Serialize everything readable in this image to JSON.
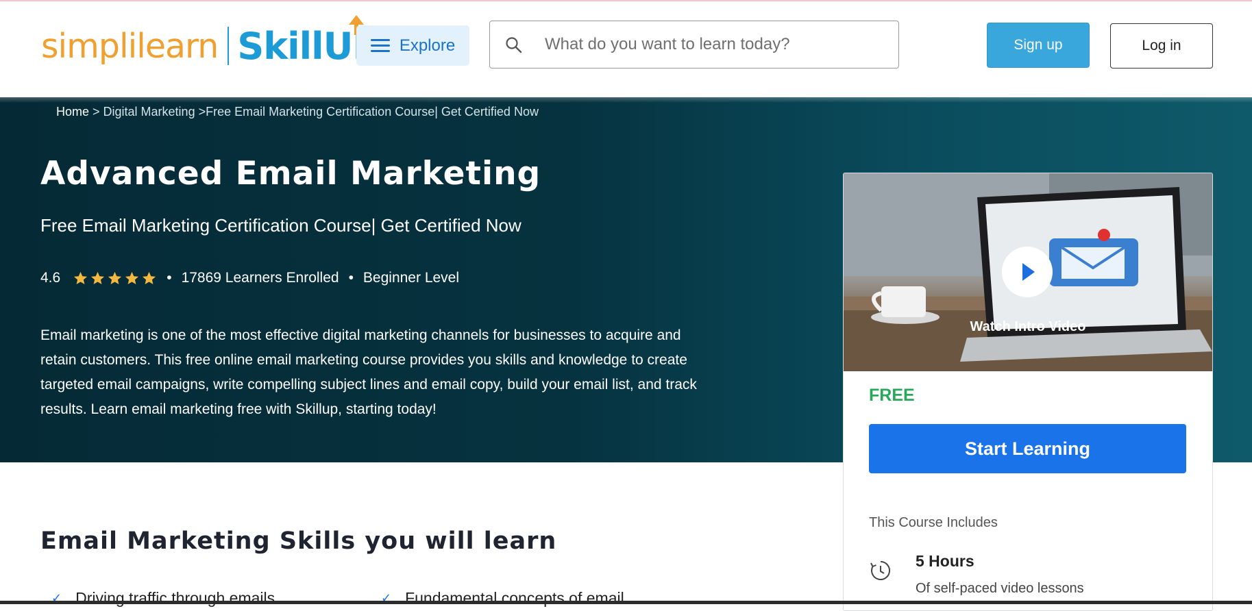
{
  "header": {
    "logo_simplilearn": "simplilearn",
    "logo_skillup": "SkillUP",
    "explore_label": "Explore",
    "search_placeholder": "What do you want to learn today?",
    "signup_label": "Sign up",
    "login_label": "Log in"
  },
  "breadcrumb": {
    "home": "Home",
    "sep1": " > ",
    "category": "Digital Marketing",
    "sep2": " >",
    "current": "Free Email Marketing Certification Course| Get Certified Now"
  },
  "course": {
    "title": "Advanced Email Marketing",
    "subtitle": "Free Email Marketing Certification Course| Get Certified Now",
    "rating": "4.6",
    "stars": 5,
    "learners": "17869 Learners Enrolled",
    "level": "Beginner Level",
    "description": "Email marketing is one of the most effective digital marketing channels for businesses to acquire and retain customers. This free online email marketing course provides you skills and knowledge to create targeted email campaigns, write compelling subject lines and email copy, build your email list, and track results. Learn email marketing free with Skillup, starting today!"
  },
  "card": {
    "watch_label": "Watch Intro Video",
    "price": "FREE",
    "start_label": "Start Learning",
    "includes_heading": "This Course Includes",
    "duration": "5 Hours",
    "duration_desc": "Of self-paced video lessons"
  },
  "skills": {
    "heading": "Email Marketing Skills you will learn",
    "items": [
      "Driving traffic through emails",
      "Fundamental concepts of email"
    ]
  },
  "colors": {
    "hero_bg": "#052a36",
    "accent_blue": "#1a73e8",
    "signup_blue": "#3aa7dc",
    "free_green": "#2aa85a",
    "star_gold": "#f4b740",
    "logo_orange": "#f0a030",
    "logo_blue": "#1c9bd6"
  }
}
